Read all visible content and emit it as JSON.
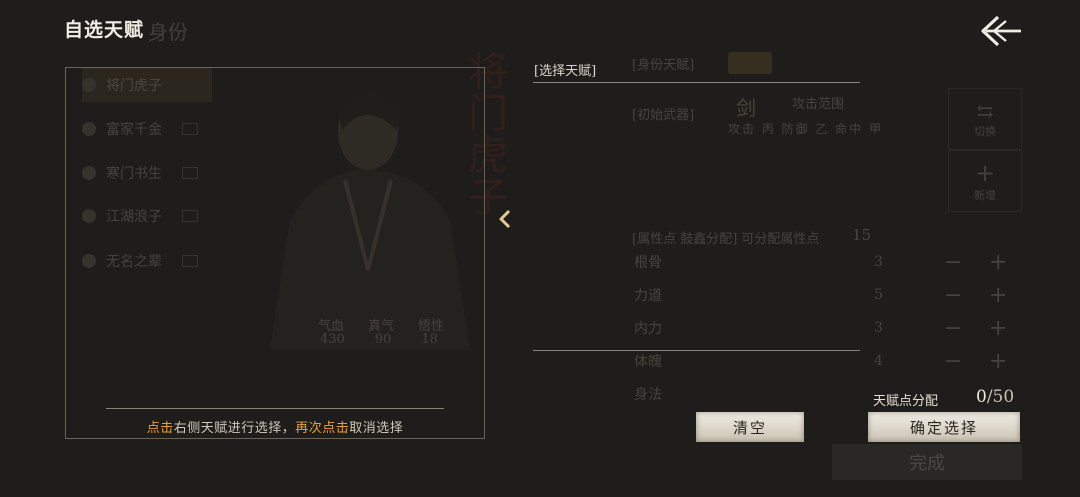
{
  "dialog": {
    "title": "自选天赋",
    "select_label": "[选择天赋]",
    "hint_pre_1": "点击",
    "hint_mid": "右侧天赋进行选择，",
    "hint_pre_2": "再次点击",
    "hint_post": "取消选择",
    "points_label": "天赋点分配",
    "points_current": "0",
    "points_total": "/50",
    "clear_label": "清空",
    "confirm_label": "确定选择"
  },
  "background": {
    "title_suffix": "身份",
    "brush_text": "将门虎子",
    "origins": [
      {
        "label": "将门虎子"
      },
      {
        "label": "富家千金"
      },
      {
        "label": "寒门书生"
      },
      {
        "label": "江湖浪子"
      },
      {
        "label": "无名之辈"
      }
    ],
    "stats_headers": [
      "气血",
      "真气",
      "悟性"
    ],
    "stats_values": [
      "430",
      "90",
      "18"
    ],
    "identity_tag": "[身份天赋]",
    "weapon_tag": "[初始武器]",
    "weapon_glyph": "剑",
    "attack_range": "攻击范围",
    "attack_row": "攻击  丙   防御  乙  命中  甲",
    "free_points": "[属性点 鼓鑫分配]  可分配属性点",
    "free_value": "15",
    "side_btn_1": "切换",
    "side_btn_2": "新增",
    "attributes": [
      {
        "name": "根骨",
        "value": "3"
      },
      {
        "name": "力道",
        "value": "5"
      },
      {
        "name": "内力",
        "value": "3"
      },
      {
        "name": "体魄",
        "value": "4"
      },
      {
        "name": "身法",
        "value": ""
      }
    ],
    "done_label": "完成"
  },
  "colors": {
    "highlight": "#e8a040",
    "paper_button": "#e6e1d6",
    "backdrop": "#1e1d1b"
  },
  "icons": {
    "back": "double-chevron-left-icon",
    "collapse": "chevron-left-icon"
  }
}
